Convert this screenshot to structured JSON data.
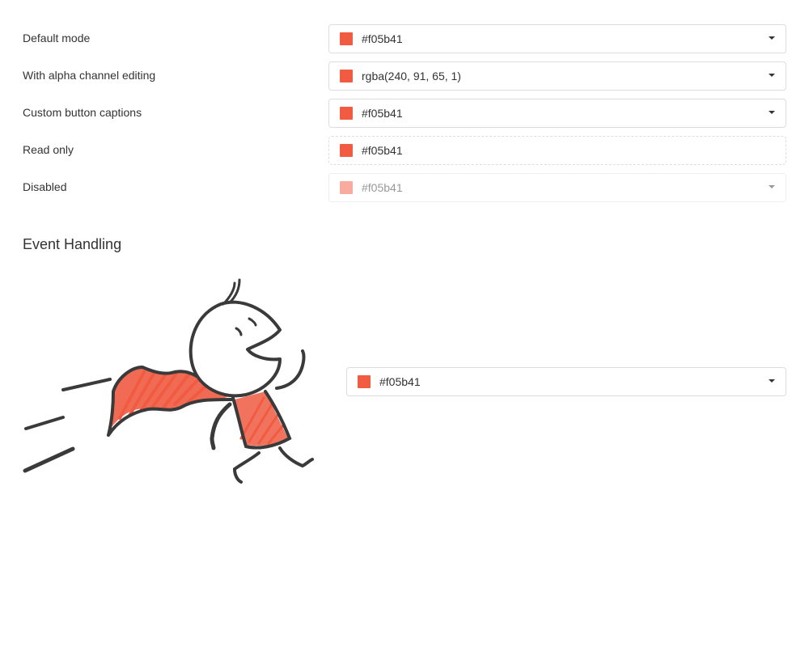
{
  "accent_color": "#f05b41",
  "settings": [
    {
      "label": "Default mode",
      "value": "#f05b41",
      "state": "normal"
    },
    {
      "label": "With alpha channel editing",
      "value": "rgba(240, 91, 65, 1)",
      "state": "normal"
    },
    {
      "label": "Custom button captions",
      "value": "#f05b41",
      "state": "normal"
    },
    {
      "label": "Read only",
      "value": "#f05b41",
      "state": "readonly"
    },
    {
      "label": "Disabled",
      "value": "#f05b41",
      "state": "disabled"
    }
  ],
  "event_handling": {
    "title": "Event Handling",
    "picker_value": "#f05b41"
  }
}
